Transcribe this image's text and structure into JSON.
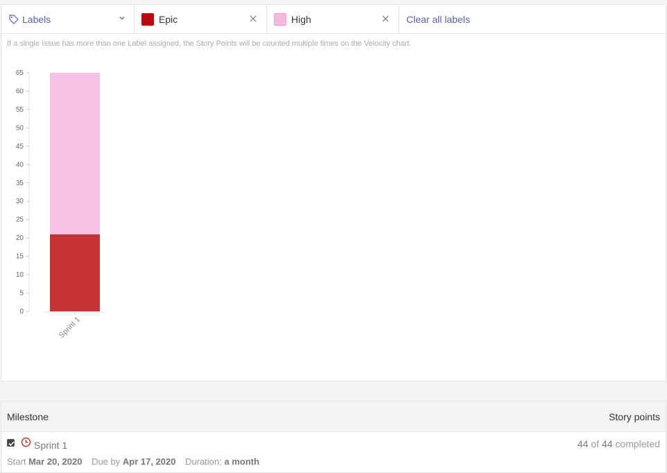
{
  "filter": {
    "labels_dropdown": "Labels",
    "chips": [
      {
        "name": "Epic",
        "color": "#b8080f"
      },
      {
        "name": "High",
        "color": "#f3b9de"
      }
    ],
    "clear_all": "Clear all labels"
  },
  "note": "If a single Issue has more than one Label assigned, the Story Points will be counted multiple times on the Velocity chart.",
  "chart_data": {
    "type": "bar",
    "stacked": true,
    "categories": [
      "Sprint 1"
    ],
    "series": [
      {
        "name": "Epic",
        "color": "#c53135",
        "values": [
          21
        ]
      },
      {
        "name": "High",
        "color": "#f5c2e3",
        "values": [
          44
        ]
      }
    ],
    "yticks": [
      "0",
      "5",
      "10",
      "15",
      "20",
      "25",
      "30",
      "35",
      "40",
      "45",
      "50",
      "55",
      "60",
      "65"
    ],
    "ylim": [
      0,
      65
    ],
    "grid": false
  },
  "table": {
    "col_milestone": "Milestone",
    "col_points": "Story points",
    "rows": [
      {
        "name": "Sprint 1",
        "checked": true,
        "points_done": "44",
        "points_of": "of",
        "points_total": "44",
        "points_suffix": "completed",
        "start_label": "Start",
        "start": "Mar 20, 2020",
        "due_label": "Due by",
        "due": "Apr 17, 2020",
        "duration_label": "Duration:",
        "duration": "a month"
      }
    ]
  }
}
